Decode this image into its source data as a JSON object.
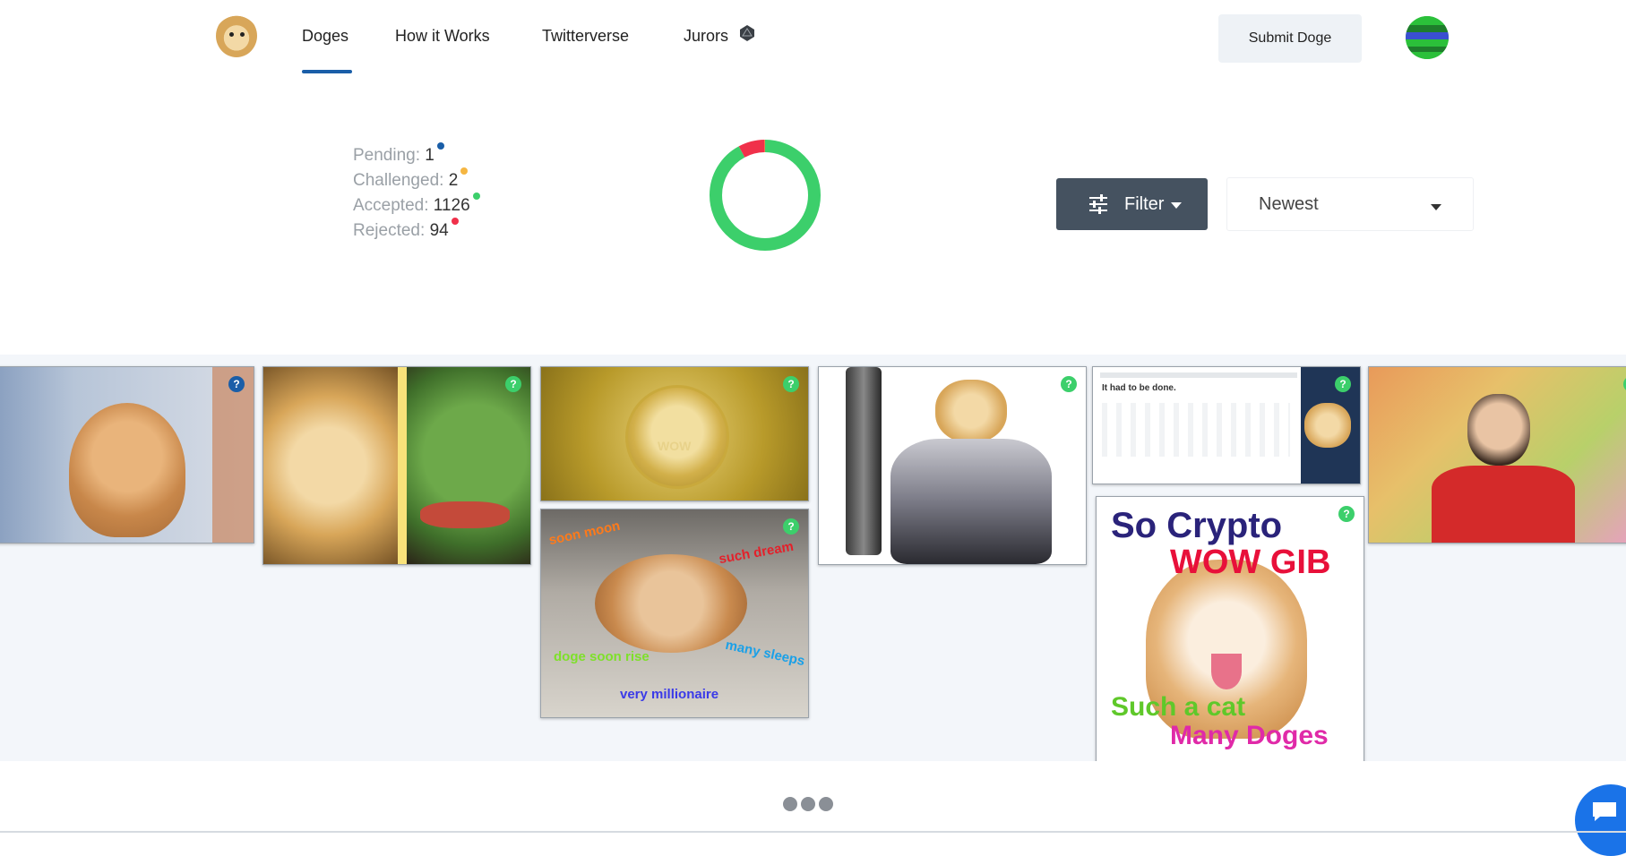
{
  "nav": {
    "items": [
      {
        "label": "Doges"
      },
      {
        "label": "How it Works"
      },
      {
        "label": "Twitterverse"
      },
      {
        "label": "Jurors"
      }
    ],
    "active": "Doges",
    "submit_label": "Submit Doge"
  },
  "stats": {
    "pending": {
      "label": "Pending:",
      "value": "1",
      "color": "#1a5ea8"
    },
    "challenged": {
      "label": "Challenged:",
      "value": "2",
      "color": "#f5b642"
    },
    "accepted": {
      "label": "Accepted:",
      "value": "1126",
      "color": "#3ccf6b"
    },
    "rejected": {
      "label": "Rejected:",
      "value": "94",
      "color": "#f0304a"
    }
  },
  "donut_counts": {
    "pending": 1,
    "challenged": 2,
    "accepted": 1126,
    "rejected": 94
  },
  "controls": {
    "filter_label": "Filter",
    "sort_value": "Newest"
  },
  "cards": {
    "crypto_text_1": "So Crypto",
    "crypto_text_2": "WOW GIB",
    "crypto_text_3": "Such a cat",
    "crypto_text_4": "Many Doges",
    "sleep_text_1": "soon moon",
    "sleep_text_2": "such dream",
    "sleep_text_3": "doge soon rise",
    "sleep_text_4": "many sleeps",
    "sleep_text_5": "very millionaire",
    "coin_text": "WOW",
    "tweet_text": "It had to be done.",
    "badge_pending": "?",
    "badge_accepted": "?"
  },
  "colors": {
    "accent": "#1a5ea8",
    "accepted": "#3ccf6b",
    "rejected": "#f0304a",
    "challenged": "#f5b642",
    "filter_bg": "#455260"
  }
}
